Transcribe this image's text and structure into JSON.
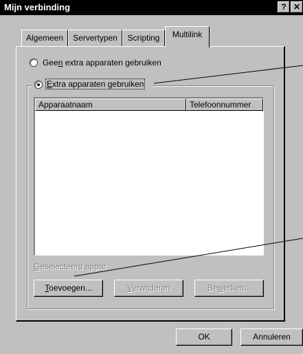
{
  "window": {
    "title": "Mijn verbinding",
    "help_button": "?",
    "close_button": "✕"
  },
  "tabs": [
    {
      "label": "Algemeen"
    },
    {
      "label": "Servertypen"
    },
    {
      "label": "Scripting"
    },
    {
      "label": "Multilink",
      "active": true
    }
  ],
  "options": {
    "no_extra": {
      "pre": "Gee",
      "u": "n",
      "post": " extra apparaten gebruiken",
      "selected": false
    },
    "extra": {
      "pre": "",
      "u": "E",
      "post": "xtra apparaten gebruiken",
      "selected": true
    }
  },
  "list": {
    "columns": [
      "Apparaatnaam",
      "Telefoonnummer"
    ],
    "rows": []
  },
  "selected_device_label": {
    "u": "G",
    "post": "eselecteerd appar"
  },
  "buttons": {
    "add": {
      "u": "T",
      "post": "oevoegen..."
    },
    "remove": {
      "pre": "",
      "u": "V",
      "post": "erwijderen"
    },
    "edit": {
      "pre": "Be",
      "u": "w",
      "post": "erken..."
    },
    "ok": "OK",
    "cancel": "Annuleren"
  }
}
